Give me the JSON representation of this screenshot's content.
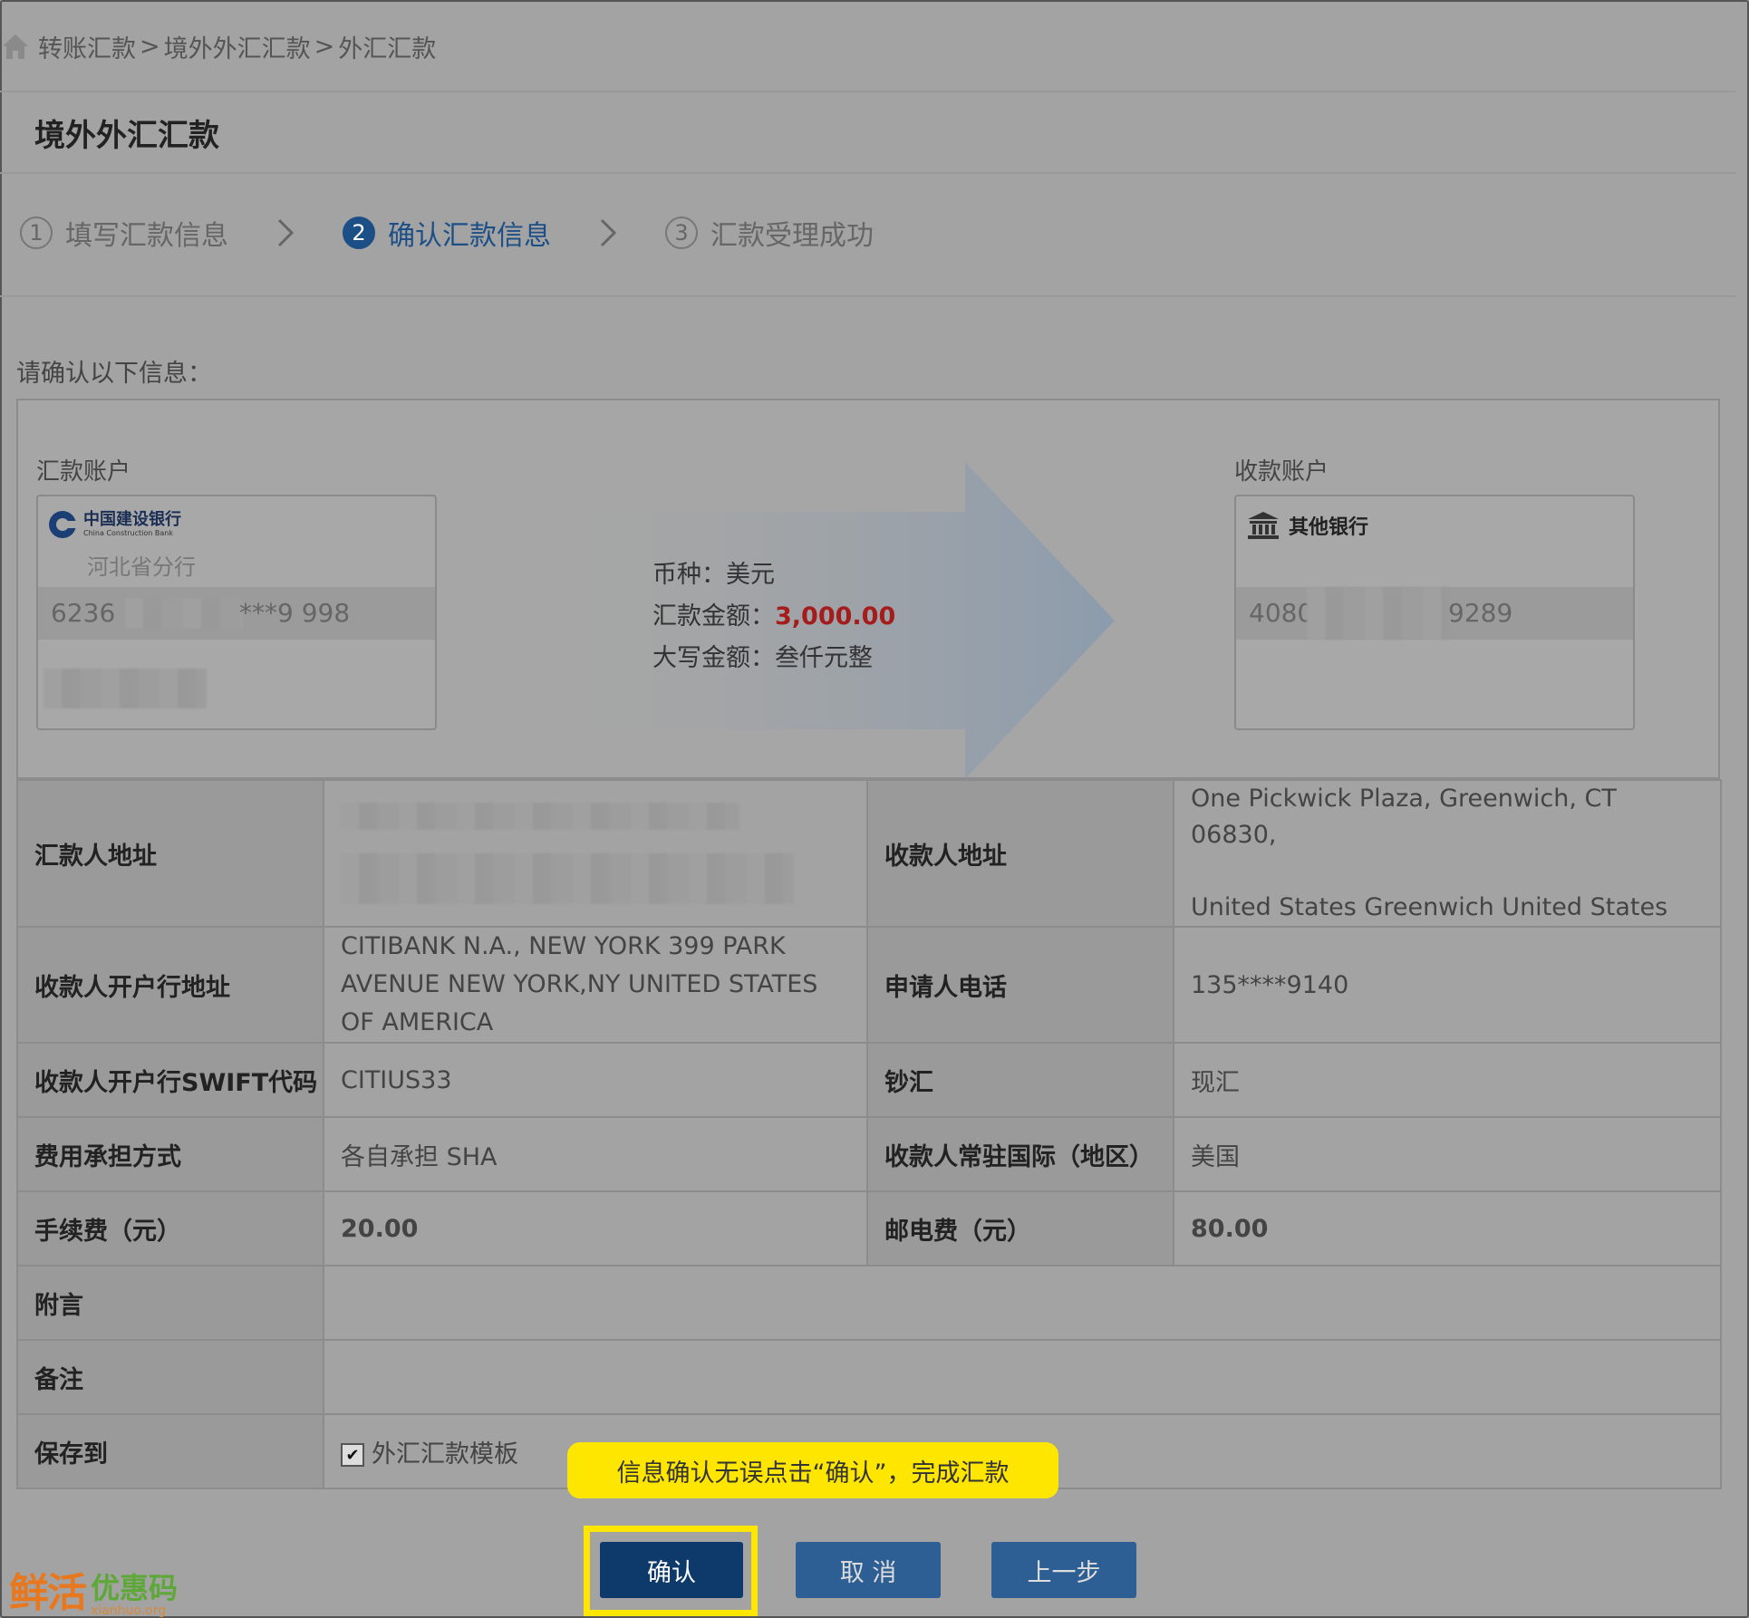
{
  "breadcrumb": [
    "转账汇款",
    "境外外汇汇款",
    "外汇汇款"
  ],
  "breadcrumb_sep": ">",
  "page_title": "境外外汇汇款",
  "steps": [
    {
      "num": "1",
      "label": "填写汇款信息"
    },
    {
      "num": "2",
      "label": "确认汇款信息"
    },
    {
      "num": "3",
      "label": "汇款受理成功"
    }
  ],
  "prompt": "请确认以下信息：",
  "remitter": {
    "label": "汇款账户",
    "bank_cn": "中国建设银行",
    "bank_en": "China Construction Bank",
    "branch": "河北省分行",
    "acct_prefix": "6236",
    "acct_suffix": "***9 998"
  },
  "payee": {
    "label": "收款账户",
    "bank": "其他银行",
    "acct_prefix": "4080",
    "acct_suffix": "9289"
  },
  "transfer": {
    "currency_label": "币种：",
    "currency": "美元",
    "amount_label": "汇款金额：",
    "amount": "3,000.00",
    "words_label": "大写金额：",
    "words": "叁仟元整"
  },
  "table": {
    "remitter_addr_label": "汇款人地址",
    "payee_addr_label": "收款人地址",
    "payee_addr_line1": "One Pickwick Plaza, Greenwich, CT 06830,",
    "payee_addr_line2": "United States Greenwich United States",
    "payee_bank_addr_label": "收款人开户行地址",
    "payee_bank_addr": "CITIBANK N.A., NEW YORK   399 PARK AVENUE NEW YORK,NY UNITED STATES OF AMERICA",
    "phone_label": "申请人电话",
    "phone": "135****9140",
    "swift_label": "收款人开户行SWIFT代码",
    "swift": "CITIUS33",
    "cash_label": "钞汇",
    "cash": "现汇",
    "fee_mode_label": "费用承担方式",
    "fee_mode": "各自承担 SHA",
    "country_label": "收款人常驻国际（地区）",
    "country": "美国",
    "fee_label": "手续费（元）",
    "fee": "20.00",
    "postal_label": "邮电费（元）",
    "postal": "80.00",
    "postscript_label": "附言",
    "remark_label": "备注",
    "save_label": "保存到",
    "save_option": "外汇汇款模板"
  },
  "tooltip": "信息确认无误点击“确认”，完成汇款",
  "buttons": {
    "confirm": "确认",
    "cancel": "取 消",
    "prev": "上一步"
  },
  "watermark": {
    "cn_big": "鲜活",
    "cn": "优惠码",
    "en": "xianhuo.org"
  },
  "colors": {
    "primary": "#0e3a6b",
    "button": "#2e5f94",
    "active_step": "#1b4f86",
    "amount_red": "#a51c1c",
    "highlight": "#ffe600"
  }
}
